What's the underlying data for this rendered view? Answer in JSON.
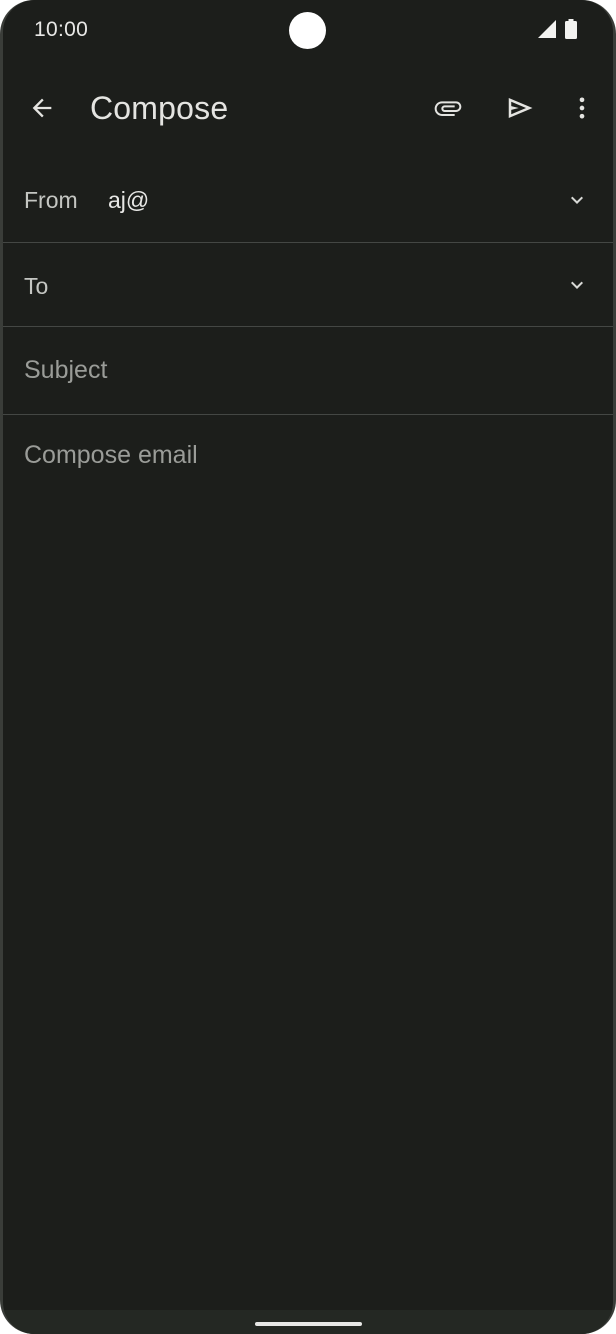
{
  "status_bar": {
    "time": "10:00",
    "icons": [
      "signal-icon",
      "battery-icon"
    ]
  },
  "app_bar": {
    "title": "Compose",
    "icons": [
      "back-arrow-icon",
      "attach-icon",
      "send-icon",
      "more-vert-icon"
    ]
  },
  "form": {
    "from_label": "From",
    "from_value": "aj@",
    "to_label": "To",
    "to_value": "",
    "subject_placeholder": "Subject",
    "body_placeholder": "Compose email"
  },
  "colors": {
    "background": "#1c1e1b",
    "text_primary": "#e4e4e1",
    "text_secondary": "#c4c6c2",
    "placeholder": "#9a9c98",
    "divider": "#444744"
  }
}
